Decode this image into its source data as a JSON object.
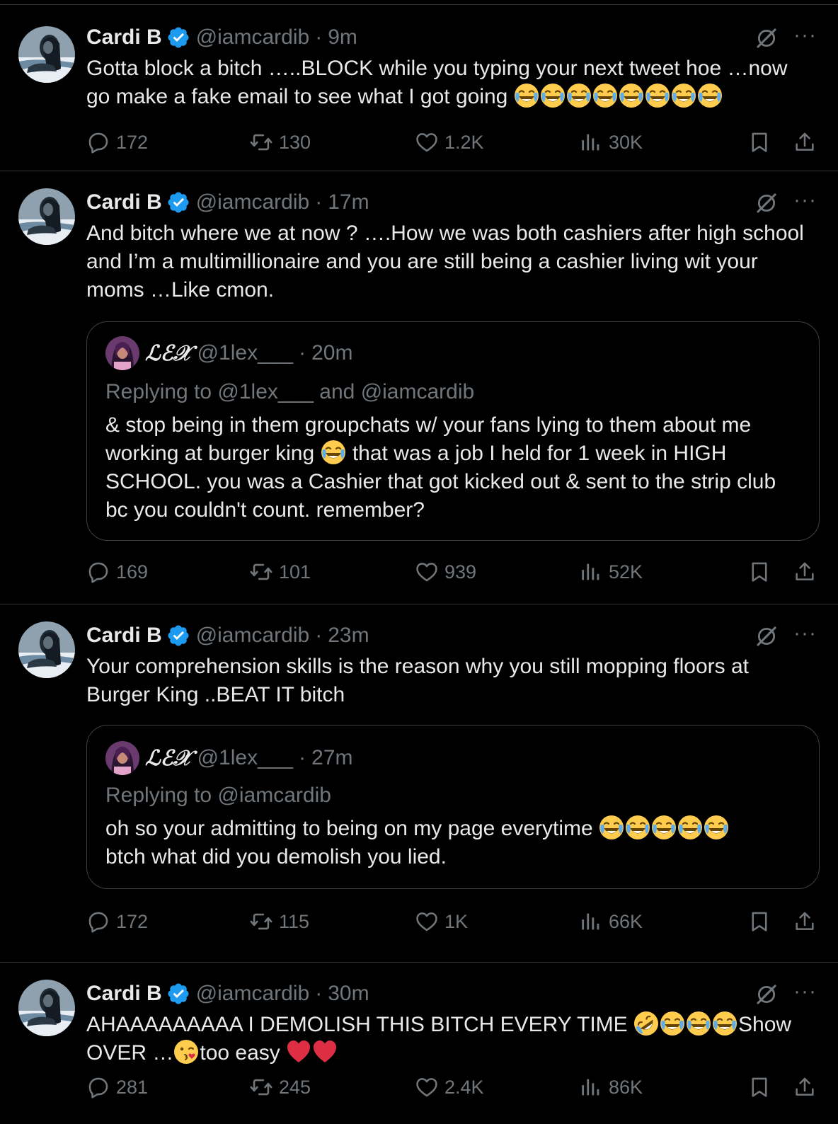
{
  "tweets": [
    {
      "name": "Cardi B",
      "handle": "@iamcardib",
      "time": "9m",
      "text_parts": [
        "Gotta block a bitch …..BLOCK while you typing your next tweet hoe …now",
        "go make a fake email to see what I got going"
      ],
      "trailing_emojis": [
        "😂",
        "😂",
        "😂",
        "😂",
        "😂",
        "😂",
        "😂",
        "😂"
      ],
      "stats": {
        "replies": "172",
        "retweets": "130",
        "likes": "1.2K",
        "views": "30K"
      }
    },
    {
      "name": "Cardi B",
      "handle": "@iamcardib",
      "time": "17m",
      "text_lines": [
        "And bitch where we at now ? ….How we was both cashiers after high school",
        "and I’m a multimillionaire and you are still being a cashier living wit your",
        "moms …Like cmon."
      ],
      "quote": {
        "name": "ℒℰ𝒳",
        "handle": "@1lex___",
        "time": "20m",
        "replying_to": "Replying to @1lex___ and @iamcardib",
        "line1": "& stop being in them groupchats w/ your fans lying to them about me",
        "line2_a": "working at burger king",
        "line2_emoji": "😂",
        "line2_b": "that was a job I held for 1 week in HIGH",
        "line3": "SCHOOL. you was a Cashier that got kicked out & sent to the strip club",
        "line4": "bc you couldn't count. remember?"
      },
      "stats": {
        "replies": "169",
        "retweets": "101",
        "likes": "939",
        "views": "52K"
      }
    },
    {
      "name": "Cardi B",
      "handle": "@iamcardib",
      "time": "23m",
      "text_lines": [
        "Your comprehension skills is the reason why you still mopping floors at",
        "Burger King ..BEAT IT bitch"
      ],
      "quote": {
        "name": "ℒℰ𝒳",
        "handle": "@1lex___",
        "time": "27m",
        "replying_to": "Replying to @iamcardib",
        "line1": "oh so your admitting to being on my page everytime",
        "line1_emojis": [
          "😂",
          "😂",
          "😂",
          "😂",
          "😂"
        ],
        "line2": "btch what did you demolish you lied."
      },
      "stats": {
        "replies": "172",
        "retweets": "115",
        "likes": "1K",
        "views": "66K"
      }
    },
    {
      "name": "Cardi B",
      "handle": "@iamcardib",
      "time": "30m",
      "line1_a": "AHAAAAAAAAA I DEMOLISH THIS BITCH EVERY TIME",
      "line1_emojis": [
        "🤣",
        "😂",
        "😂",
        "😂"
      ],
      "line1_b": "Show",
      "line2_a": "OVER …",
      "line2_emoji": "😘",
      "line2_b": "too easy",
      "line2_emojis": [
        "❤️",
        "❤️"
      ],
      "stats": {
        "replies": "281",
        "retweets": "245",
        "likes": "2.4K",
        "views": "86K"
      }
    }
  ],
  "icons": {
    "verified": "verified-badge-icon",
    "grok": "grok-icon",
    "more": "more-icon",
    "reply": "reply-icon",
    "retweet": "retweet-icon",
    "like": "heart-icon",
    "views": "views-icon",
    "bookmark": "bookmark-icon",
    "share": "share-icon"
  },
  "colors": {
    "background": "#000000",
    "text": "#e7e9ea",
    "muted": "#71767b",
    "verified": "#1d9bf0",
    "divider": "#2f3336"
  }
}
